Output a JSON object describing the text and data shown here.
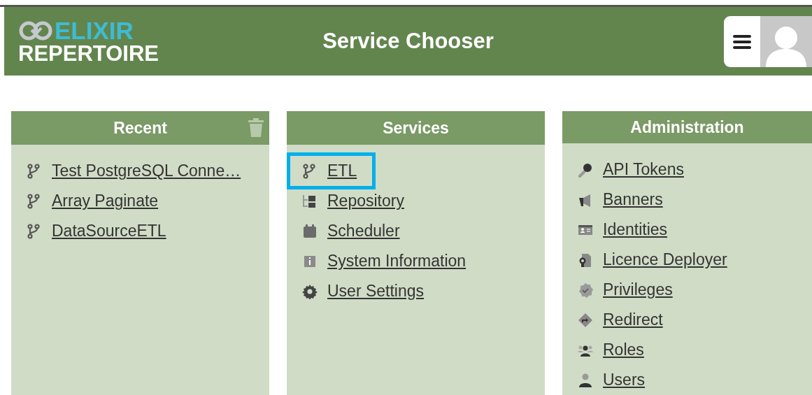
{
  "header": {
    "logo_top": "ELIXIR",
    "logo_bottom": "REPERTOIRE",
    "title": "Service Chooser"
  },
  "panels": [
    {
      "title": "Recent",
      "has_clear": true,
      "items": [
        {
          "label": "Test PostgreSQL Conne…",
          "kind": "branch",
          "highlighted": false
        },
        {
          "label": "Array Paginate",
          "kind": "branch",
          "highlighted": false
        },
        {
          "label": "DataSourceETL",
          "kind": "branch",
          "highlighted": false
        }
      ]
    },
    {
      "title": "Services",
      "has_clear": false,
      "items": [
        {
          "label": "ETL",
          "kind": "branch",
          "highlighted": true
        },
        {
          "label": "Repository",
          "kind": "repository",
          "highlighted": false
        },
        {
          "label": "Scheduler",
          "kind": "calendar",
          "highlighted": false
        },
        {
          "label": "System Information",
          "kind": "info",
          "highlighted": false
        },
        {
          "label": "User Settings",
          "kind": "gear",
          "highlighted": false
        }
      ]
    },
    {
      "title": "Administration",
      "has_clear": false,
      "items": [
        {
          "label": "API Tokens",
          "kind": "key",
          "highlighted": false
        },
        {
          "label": "Banners",
          "kind": "megaphone",
          "highlighted": false
        },
        {
          "label": "Identities",
          "kind": "idcard",
          "highlighted": false
        },
        {
          "label": "Licence Deployer",
          "kind": "licence",
          "highlighted": false
        },
        {
          "label": "Privileges",
          "kind": "badge",
          "highlighted": false
        },
        {
          "label": "Redirect",
          "kind": "redirect",
          "highlighted": false
        },
        {
          "label": "Roles",
          "kind": "roles",
          "highlighted": false
        },
        {
          "label": "Users",
          "kind": "user",
          "highlighted": false
        }
      ]
    }
  ]
}
